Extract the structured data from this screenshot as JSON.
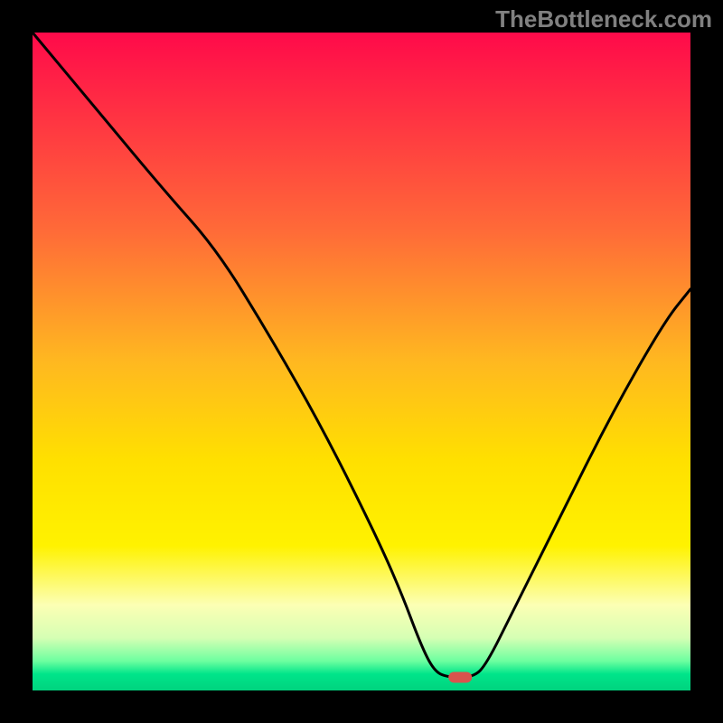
{
  "watermark": "TheBottleneck.com",
  "chart_data": {
    "type": "line",
    "title": "",
    "xlabel": "",
    "ylabel": "",
    "xlim": [
      0,
      100
    ],
    "ylim": [
      0,
      100
    ],
    "grid": false,
    "legend": false,
    "annotations": [],
    "background_gradient": {
      "direction": "top-to-bottom",
      "stops": [
        {
          "pos": 0.0,
          "color": "#ff0a4a"
        },
        {
          "pos": 0.3,
          "color": "#ff6a38"
        },
        {
          "pos": 0.5,
          "color": "#ffb820"
        },
        {
          "pos": 0.65,
          "color": "#ffe000"
        },
        {
          "pos": 0.78,
          "color": "#fff200"
        },
        {
          "pos": 0.87,
          "color": "#fcffb4"
        },
        {
          "pos": 0.92,
          "color": "#d6ffb4"
        },
        {
          "pos": 0.955,
          "color": "#6effa0"
        },
        {
          "pos": 0.975,
          "color": "#00e58a"
        },
        {
          "pos": 1.0,
          "color": "#00d37e"
        }
      ]
    },
    "series": [
      {
        "name": "bottleneck-curve",
        "color": "#000000",
        "x": [
          0.0,
          10.0,
          20.0,
          28.0,
          36.0,
          44.0,
          52.0,
          56.0,
          59.0,
          61.0,
          63.0,
          67.0,
          69.0,
          73.0,
          80.0,
          88.0,
          96.0,
          100.0
        ],
        "y": [
          100.0,
          88.0,
          76.0,
          67.0,
          54.0,
          40.0,
          24.0,
          15.0,
          7.0,
          3.0,
          2.0,
          2.0,
          4.0,
          12.0,
          26.0,
          42.0,
          56.0,
          61.0
        ]
      }
    ],
    "marker": {
      "name": "optimal-point",
      "x": 65.0,
      "y": 2.0,
      "color": "#d9544d",
      "shape": "rounded-rect"
    }
  }
}
